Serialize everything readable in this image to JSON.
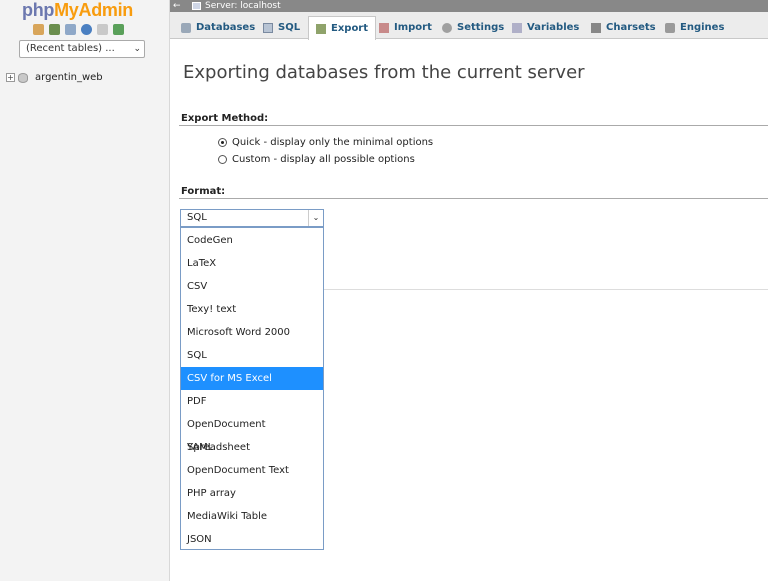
{
  "sidebar": {
    "logo_php": "php",
    "logo_my": "MyAdmin",
    "recent_tables": "(Recent tables) ...",
    "db_name": "argentin_web"
  },
  "serverbar": {
    "back": "←",
    "title": "Server: localhost"
  },
  "tabs": [
    {
      "label": "Databases",
      "icon": "databases-icon"
    },
    {
      "label": "SQL",
      "icon": "sql-icon"
    },
    {
      "label": "Export",
      "icon": "export-icon",
      "active": true
    },
    {
      "label": "Import",
      "icon": "import-icon"
    },
    {
      "label": "Settings",
      "icon": "settings-icon"
    },
    {
      "label": "Variables",
      "icon": "variables-icon"
    },
    {
      "label": "Charsets",
      "icon": "charsets-icon"
    },
    {
      "label": "Engines",
      "icon": "engines-icon"
    }
  ],
  "main": {
    "title": "Exporting databases from the current server",
    "export_method_label": "Export Method:",
    "method_quick": "Quick - display only the minimal options",
    "method_custom": "Custom - display all possible options",
    "format_label": "Format:",
    "format_selected": "SQL"
  },
  "format_options": [
    "CodeGen",
    "LaTeX",
    "CSV",
    "Texy! text",
    "Microsoft Word 2000",
    "SQL",
    "CSV for MS Excel",
    "PDF",
    "OpenDocument Spreadsheet",
    "YAML",
    "OpenDocument Text",
    "PHP array",
    "MediaWiki Table",
    "JSON"
  ],
  "highlighted_option": "CSV for MS Excel",
  "colors": {
    "tab_text": "#235a81",
    "highlight": "#1e90ff",
    "logo_php": "#6c78af",
    "logo_myadmin": "#f89c0e"
  }
}
